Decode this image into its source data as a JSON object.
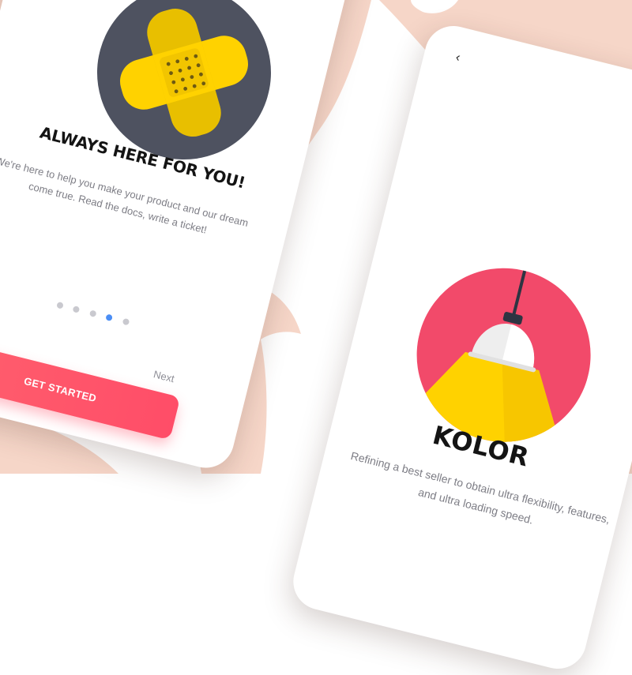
{
  "colors": {
    "background_shape": "#f6d6c8",
    "primary_cta": "#ff4d68",
    "kolor_circle": "#f24a6a",
    "bandage_circle": "#4e5260",
    "bandage_yellow": "#ffd200",
    "active_dot": "#4b8ef5"
  },
  "screen1": {
    "illustration_icon": "bandage-icon",
    "title": "ALWAYS HERE FOR YOU!",
    "description": "We're here to help you make your product and our dream come true. Read the docs, write a ticket!",
    "pagination": {
      "count": 5,
      "active_index": 3
    },
    "cta_label": "GET STARTED",
    "next_label": "Next"
  },
  "screen2": {
    "back_icon": "chevron-left-icon",
    "back_glyph": "‹",
    "illustration_icon": "lamp-icon",
    "title": "KOLOR",
    "description": "Refining a best seller to obtain ultra flexibility, features, and ultra loading speed."
  }
}
